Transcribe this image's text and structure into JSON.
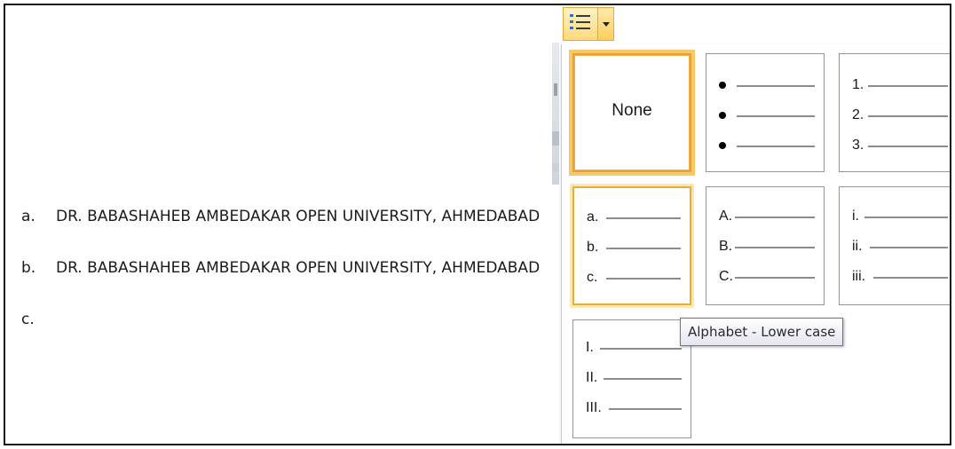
{
  "document": {
    "lines": [
      {
        "marker": "a.",
        "text": "DR. BABASHAHEB AMBEDAKAR OPEN UNIVERSITY, AHMEDABAD"
      },
      {
        "marker": "b.",
        "text": "DR. BABASHAHEB AMBEDAKAR OPEN UNIVERSITY, AHMEDABAD"
      },
      {
        "marker": "c.",
        "text": ""
      }
    ]
  },
  "toolbar": {
    "numbering_button_icon": "numbered-list-icon",
    "dropdown_arrow_icon": "chevron-down-icon"
  },
  "gallery": {
    "none_label": "None",
    "formats": [
      {
        "id": "bullets",
        "markers": [
          "",
          "",
          ""
        ]
      },
      {
        "id": "arabic",
        "markers": [
          "1.",
          "2.",
          "3."
        ]
      },
      {
        "id": "alpha-lower",
        "markers": [
          "a.",
          "b.",
          "c."
        ]
      },
      {
        "id": "alpha-upper",
        "markers": [
          "A.",
          "B.",
          "C."
        ]
      },
      {
        "id": "roman-lower",
        "markers": [
          "i.",
          "ii.",
          "iii."
        ]
      },
      {
        "id": "roman-upper",
        "markers": [
          "I.",
          "II.",
          "III."
        ]
      }
    ],
    "hovered": "alpha-lower"
  },
  "tooltip": {
    "text": "Alphabet - Lower case"
  },
  "colors": {
    "hover_border": "#e8ac3a",
    "tooltip_border": "#767676"
  }
}
